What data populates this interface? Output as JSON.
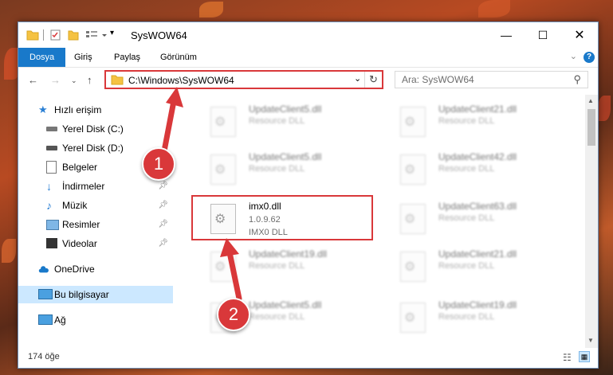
{
  "window": {
    "title": "SysWOW64",
    "controls": [
      "minimize",
      "maximize",
      "close"
    ]
  },
  "ribbon": {
    "tabs": [
      "Dosya",
      "Giriş",
      "Paylaş",
      "Görünüm"
    ],
    "help": "?"
  },
  "navbar": {
    "address": "C:\\Windows\\SysWOW64",
    "search_placeholder": "Ara: SysWOW64"
  },
  "sidebar": {
    "items": [
      {
        "label": "Hızlı erişim",
        "icon": "star-icon"
      },
      {
        "label": "Yerel Disk (C:)",
        "icon": "drive-icon"
      },
      {
        "label": "Yerel Disk (D:)",
        "icon": "drive-icon"
      },
      {
        "label": "Belgeler",
        "icon": "documents-icon"
      },
      {
        "label": "İndirmeler",
        "icon": "downloads-icon"
      },
      {
        "label": "Müzik",
        "icon": "music-icon"
      },
      {
        "label": "Resimler",
        "icon": "pictures-icon"
      },
      {
        "label": "Videolar",
        "icon": "videos-icon"
      },
      {
        "label": "OneDrive",
        "icon": "cloud-icon"
      },
      {
        "label": "Bu bilgisayar",
        "icon": "computer-icon"
      },
      {
        "label": "Ağ",
        "icon": "network-icon"
      }
    ],
    "selected": "Bu bilgisayar"
  },
  "files": {
    "left": [
      {
        "name": "UpdateClient5.dll",
        "desc": "Resource DLL"
      },
      {
        "name": "UpdateClient5.dll",
        "desc": "Resource DLL"
      },
      {
        "name": "imx0.dll",
        "version": "1.0.9.62",
        "desc": "IMX0 DLL"
      },
      {
        "name": "UpdateClient19.dll",
        "desc": "Resource DLL"
      },
      {
        "name": "UpdateClient5.dll",
        "desc": "Resource DLL"
      }
    ],
    "right": [
      {
        "name": "UpdateClient21.dll",
        "desc": "Resource DLL"
      },
      {
        "name": "UpdateClient42.dll",
        "desc": "Resource DLL"
      },
      {
        "name": "UpdateClient63.dll",
        "desc": "Resource DLL"
      },
      {
        "name": "UpdateClient21.dll",
        "desc": "Resource DLL"
      },
      {
        "name": "UpdateClient19.dll",
        "desc": "Resource DLL"
      }
    ]
  },
  "status": {
    "item_count": "174 öğe"
  },
  "annotations": {
    "step1": "1",
    "step2": "2"
  },
  "colors": {
    "accent": "#1979ca",
    "highlight": "#d9383a",
    "selected": "#cce8ff"
  }
}
